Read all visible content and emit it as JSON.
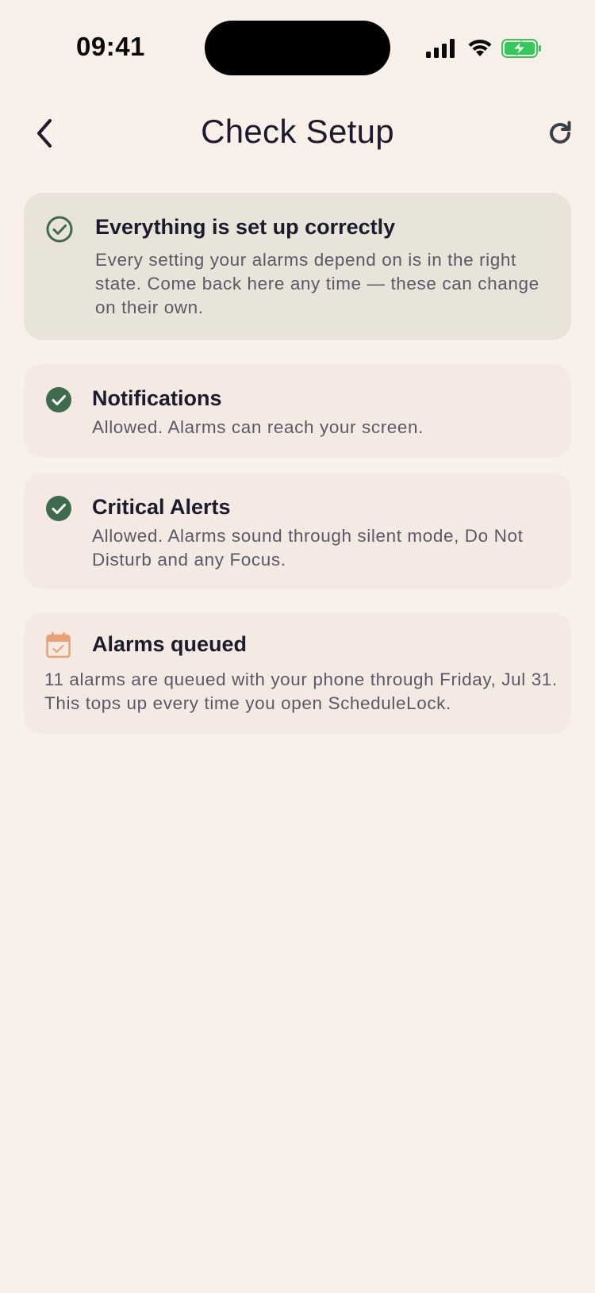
{
  "status_bar": {
    "time": "09:41"
  },
  "header": {
    "title": "Check Setup",
    "back_icon": "chevron-left-icon",
    "refresh_icon": "refresh-icon"
  },
  "summary": {
    "title": "Everything is set up correctly",
    "description": "Every setting your alarms depend on is in the right state. Come back here any time — these can change on their own.",
    "icon": "check-circle-outline-icon"
  },
  "checks": [
    {
      "title": "Notifications",
      "description": "Allowed. Alarms can reach your screen.",
      "icon": "check-circle-filled-icon"
    },
    {
      "title": "Critical Alerts",
      "description": "Allowed. Alarms sound through silent mode, Do Not Disturb and any Focus.",
      "icon": "check-circle-filled-icon"
    }
  ],
  "queued": {
    "title": "Alarms queued",
    "description": "11 alarms are queued with your phone through Friday, Jul 31. This tops up every time you open ScheduleLock.",
    "icon": "calendar-check-icon"
  },
  "colors": {
    "background": "#FAF0EA",
    "card": "#F4E9E3",
    "summary_card": "#E8E4D9",
    "success_green": "#3E6B4B",
    "calendar_orange": "#E8A077",
    "text_primary": "#1C1B2E",
    "text_secondary": "#5B5867",
    "battery_green": "#34C759"
  }
}
